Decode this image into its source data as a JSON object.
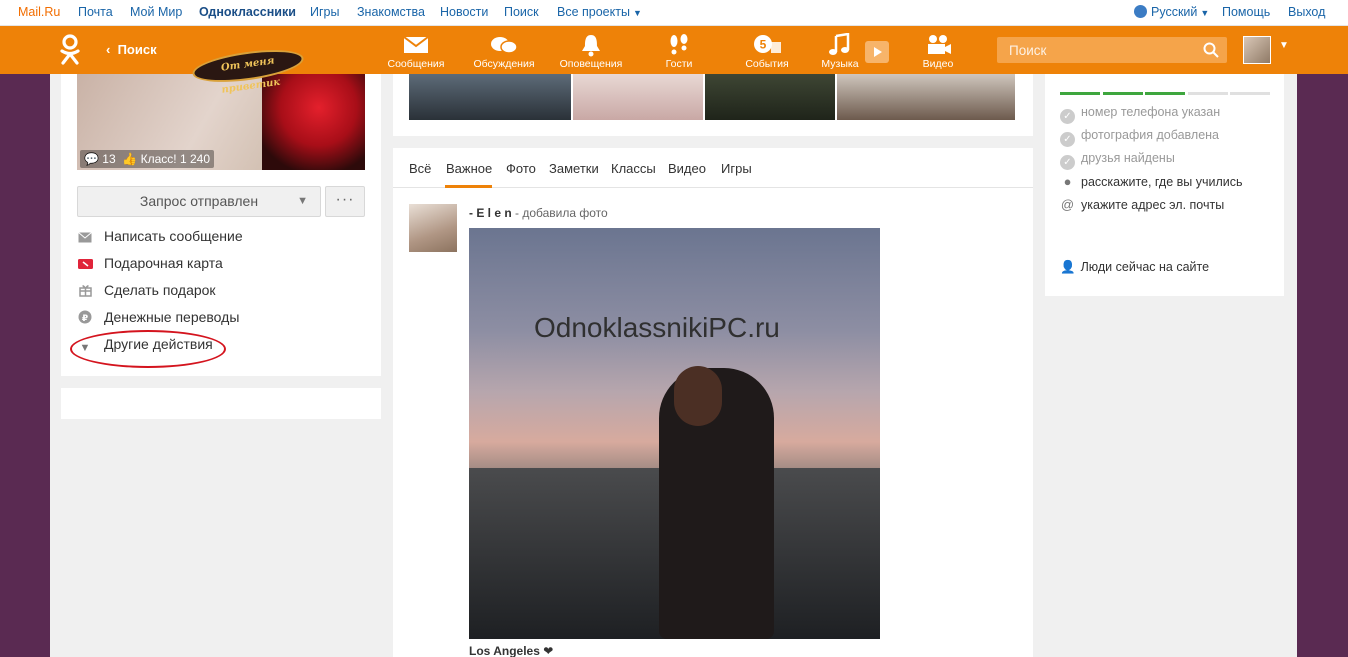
{
  "topbar": {
    "links": [
      "Mail.Ru",
      "Почта",
      "Мой Мир",
      "Одноклассники",
      "Игры",
      "Знакомства",
      "Новости",
      "Поиск",
      "Все проекты"
    ],
    "language": "Русский",
    "help": "Помощь",
    "logout": "Выход"
  },
  "header": {
    "back_label": "Поиск",
    "nav": [
      {
        "label": "Сообщения",
        "icon": "envelope-icon"
      },
      {
        "label": "Обсуждения",
        "icon": "chat-bubbles-icon"
      },
      {
        "label": "Оповещения",
        "icon": "bell-icon"
      },
      {
        "label": "Гости",
        "icon": "footprints-icon"
      },
      {
        "label": "События",
        "icon": "events-icon",
        "badge": "5"
      },
      {
        "label": "Музыка",
        "icon": "music-note-icon"
      },
      {
        "label": "Видео",
        "icon": "video-camera-icon"
      }
    ],
    "search_placeholder": "Поиск"
  },
  "profile": {
    "photo_comments": "13",
    "photo_likes": "Класс! 1 240",
    "gift_text": "От меня приветик",
    "request_button": "Запрос отправлен",
    "more_button": "···",
    "actions": [
      {
        "label": "Написать сообщение",
        "icon": "envelope-icon"
      },
      {
        "label": "Подарочная карта",
        "icon": "gift-card-icon"
      },
      {
        "label": "Сделать подарок",
        "icon": "gift-icon"
      },
      {
        "label": "Денежные переводы",
        "icon": "ruble-icon"
      },
      {
        "label": "Другие действия",
        "icon": "triangle-down-icon"
      }
    ]
  },
  "feed": {
    "tabs": [
      "Всё",
      "Важное",
      "Фото",
      "Заметки",
      "Классы",
      "Видео",
      "Игры"
    ],
    "active_tab": "Важное",
    "post": {
      "author": "- E l e n",
      "action": " - добавила фото",
      "watermark": "OdnoklassnikiPC.ru",
      "caption": "Los Angeles ❤"
    }
  },
  "profile_completion": {
    "done": [
      "номер телефона указан",
      "фотография добавлена",
      "друзья найдены"
    ],
    "todo": [
      {
        "label": "расскажите, где вы учились",
        "icon": "location-pin-icon"
      },
      {
        "label": "укажите адрес эл. почты",
        "icon": "at-sign-icon"
      }
    ],
    "people_online": "Люди сейчас на сайте",
    "progress_filled": 3,
    "progress_total": 5,
    "colors": {
      "filled": "#3ea63e",
      "empty": "#e0e0e0"
    }
  }
}
